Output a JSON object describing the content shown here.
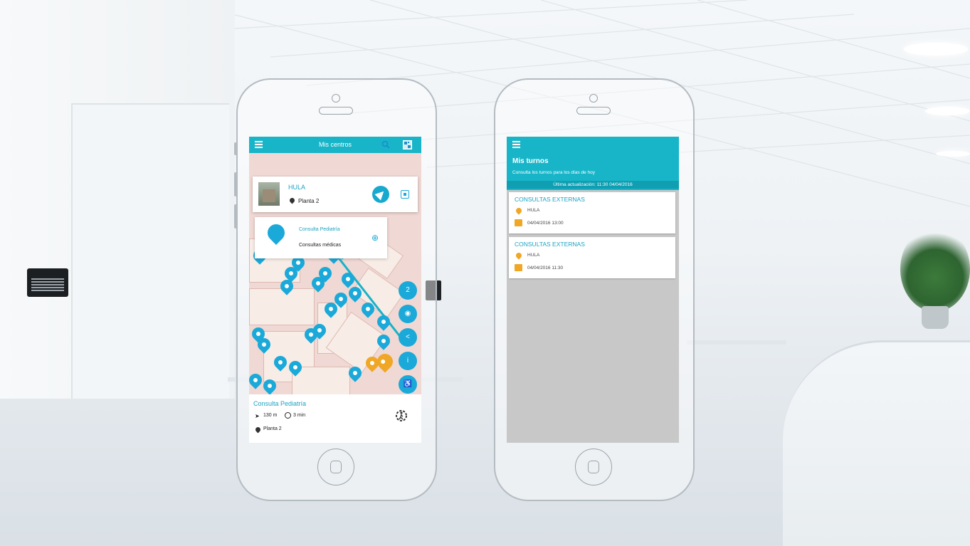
{
  "phone_map": {
    "header": {
      "title": "Mis centros"
    },
    "center_card": {
      "name": "HULA",
      "floor": "Planta 2"
    },
    "poi_card": {
      "title": "Consulta Pediatría",
      "subtitle": "Consultas médicas"
    },
    "level_badge": "2",
    "route_card": {
      "title": "Consulta Pediatría",
      "distance": "130 m",
      "time": "3 min",
      "floor": "Planta 2"
    },
    "icons": [
      "menu-icon",
      "search-icon",
      "qr-icon",
      "location-pin-icon",
      "navigate-icon",
      "target-icon",
      "add-favorite-icon",
      "eye-icon",
      "share-icon",
      "info-icon",
      "accessibility-icon",
      "walking-icon",
      "clock-icon"
    ],
    "colors": {
      "primary": "#18b5c8",
      "pin": "#1aa9d8",
      "accent": "#f0a726"
    }
  },
  "phone_turns": {
    "header": {
      "title": "Mis turnos",
      "subtitle": "Consulta los turnos para los días de hoy",
      "updated": "Última actualización: 11:30 04/04/2016"
    },
    "turns": [
      {
        "service": "CONSULTAS EXTERNAS",
        "center": "HULA",
        "datetime": "04/04/2016 13:00"
      },
      {
        "service": "CONSULTAS EXTERNAS",
        "center": "HULA",
        "datetime": "04/04/2016 11:30"
      }
    ]
  }
}
